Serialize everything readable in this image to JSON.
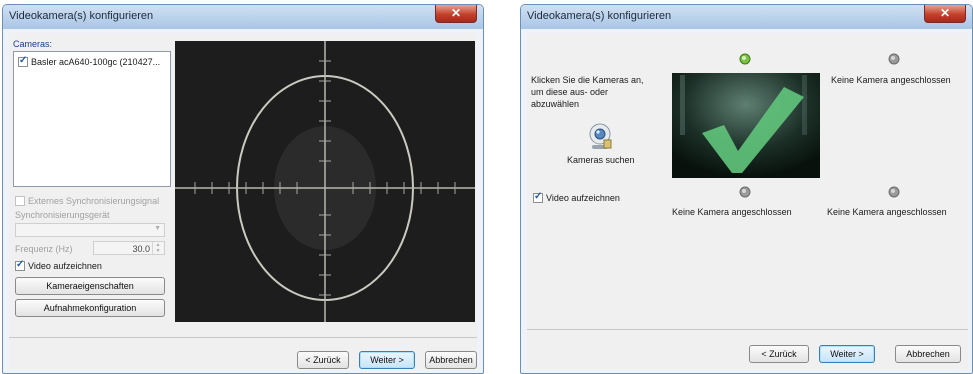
{
  "left": {
    "title": "Videokamera(s) konfigurieren",
    "close": "✕",
    "cameras_label": "Cameras:",
    "camera_item": "Basler acA640-100gc (210427...",
    "external_sync": "Externes Synchronisierungsignal",
    "sync_device": "Synchronisierungsgerät",
    "frequency_label": "Frequenz (Hz)",
    "frequency_value": "30.0",
    "record_video": "Video aufzeichnen",
    "camera_props_button": "Kameraeigenschaften",
    "recording_config_button": "Aufnahmekonfiguration",
    "back_button": "< Zurück",
    "next_button": "Weiter >",
    "cancel_button": "Abbrechen"
  },
  "right": {
    "title": "Videokamera(s) konfigurieren",
    "close": "✕",
    "instructions_line1": "Klicken Sie die Kameras an,",
    "instructions_line2": "um diese aus- oder",
    "instructions_line3": "abzuwählen",
    "search_cameras": "Kameras suchen",
    "record_video": "Video aufzeichnen",
    "no_camera_top_right": "Keine Kamera angeschlossen",
    "no_camera_bottom_left": "Keine Kamera angeschlossen",
    "no_camera_bottom_right": "Keine Kamera angeschlossen",
    "back_button": "< Zurück",
    "next_button": "Weiter >",
    "cancel_button": "Abbrechen"
  }
}
